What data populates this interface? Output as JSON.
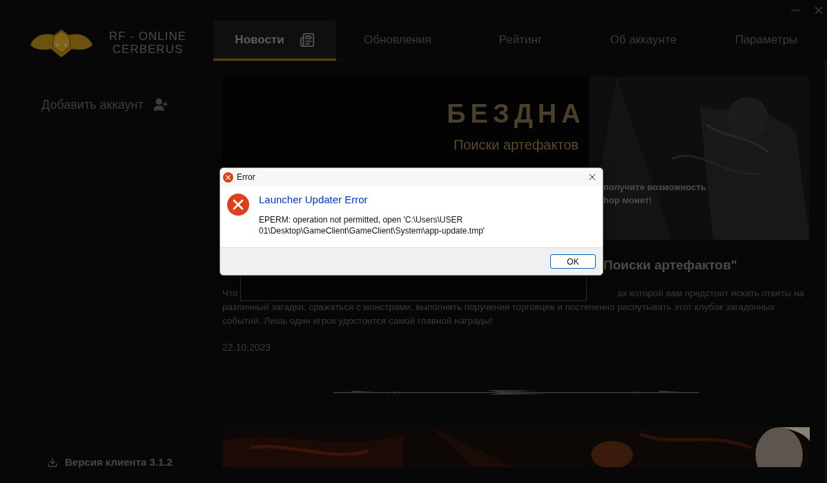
{
  "logo": {
    "line_1": "RF - ONLINE",
    "line_2": "CERBERUS"
  },
  "tabs": [
    {
      "label": "Новости",
      "selected": true
    },
    {
      "label": "Обновления",
      "selected": false
    },
    {
      "label": "Рейтинг",
      "selected": false
    },
    {
      "label": "Об аккаунте",
      "selected": false
    },
    {
      "label": "Параметры",
      "selected": false
    }
  ],
  "sidebar": {
    "add_account": "Добавить аккаунт",
    "version": "Версия клиента 3.1.2"
  },
  "banner": {
    "title": "БЕЗДНА",
    "subtitle": "Поиски артефактов",
    "text_lines": [
      "получите возможность",
      "hop монет!"
    ]
  },
  "article": {
    "heading": "Поиски артефактов\"",
    "paragraph_lines": [
      [
        "Что",
        "ах которой вам предстоит искать ответы на"
      ],
      [
        "различный загадки, сражаться с монстрами, выполнять поручения торговцев и постепенно распутывать этот клубок загадочных"
      ],
      [
        "событий. Лишь один игрок удостоится самой главной награды!"
      ]
    ],
    "date": "22.10.2023"
  },
  "dialog": {
    "title": "Error",
    "heading": "Launcher Updater Error",
    "message": "EPERM: operation not permitted, open 'C:\\Users\\USER 01\\Desktop\\GameClient\\GameClient\\System\\app-update.tmp'",
    "button": "OK"
  }
}
